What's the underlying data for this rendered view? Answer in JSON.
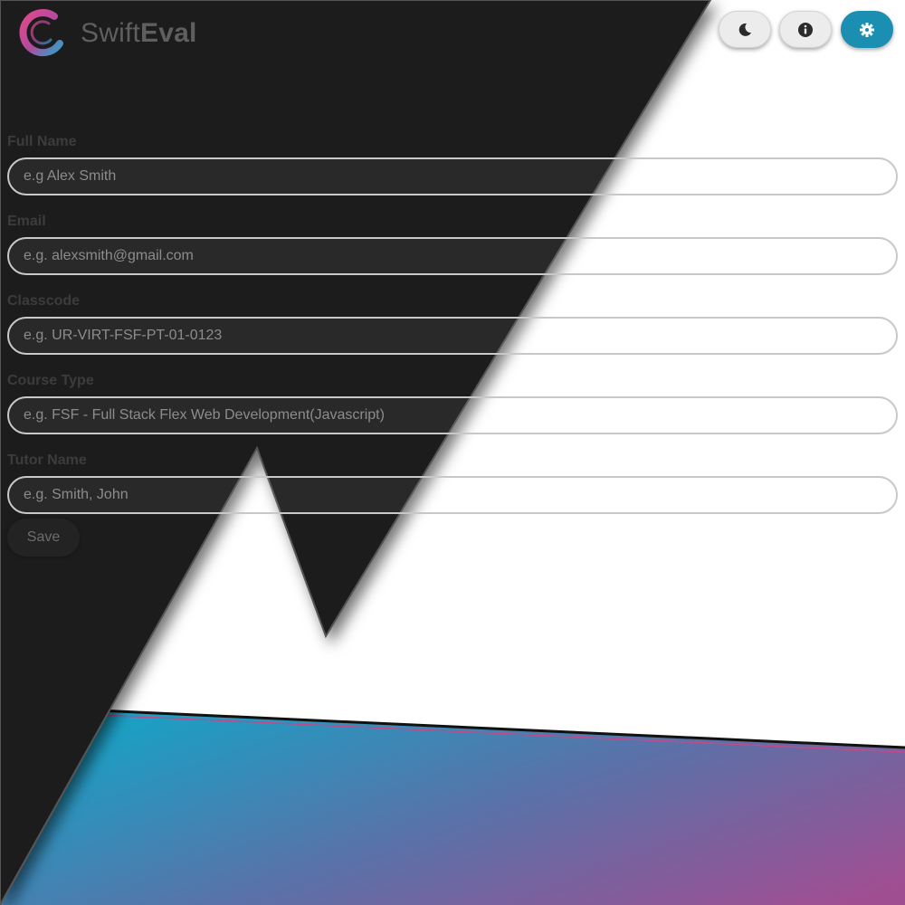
{
  "app": {
    "brand_light": "Swift",
    "brand_bold": "Eval"
  },
  "header": {
    "buttons": [
      {
        "icon": "moon-icon"
      },
      {
        "icon": "info-icon"
      },
      {
        "icon": "gear-icon"
      }
    ]
  },
  "form": {
    "fields": [
      {
        "label": "Full Name",
        "placeholder": "e.g Alex Smith"
      },
      {
        "label": "Email",
        "placeholder": "e.g. alexsmith@gmail.com"
      },
      {
        "label": "Classcode",
        "placeholder": "e.g. UR-VIRT-FSF-PT-01-0123"
      },
      {
        "label": "Course Type",
        "placeholder": "e.g. FSF - Full Stack Flex Web Development(Javascript)"
      },
      {
        "label": "Tutor Name",
        "placeholder": "e.g. Smith, John"
      }
    ],
    "save_label": "Save"
  },
  "colors": {
    "dark_panel": "#1b1b1b",
    "accent": "#1a8fb2",
    "gradient_start": "#1aa0c4",
    "gradient_end": "#a04e92"
  }
}
